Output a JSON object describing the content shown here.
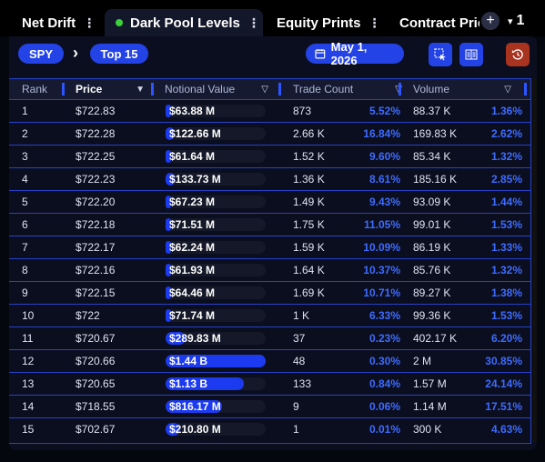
{
  "tabs": [
    {
      "label": "Net Drift",
      "kebab": "⋮"
    },
    {
      "label": "Dark Pool Levels",
      "kebab": "⋮"
    },
    {
      "label": "Equity Prints",
      "kebab": "⋮"
    },
    {
      "label": "Contract Pric"
    }
  ],
  "tabbar": {
    "plus": "+",
    "more_caret": "▾",
    "more_count": "1"
  },
  "toolbar": {
    "ticker": "SPY",
    "chevron": "›",
    "filter": "Top 15",
    "date": "May 1, 2026"
  },
  "columns": {
    "rank": "Rank",
    "price": "Price",
    "notional": "Notional Value",
    "trade_count": "Trade Count",
    "volume": "Volume",
    "sort_desc": "▼",
    "filter_icon": "▽"
  },
  "rows": [
    {
      "rank": "1",
      "price": "$722.83",
      "notional": "$63.88 M",
      "notional_frac": 0.044,
      "trades": "873",
      "trades_pct": "5.52%",
      "volume": "88.37 K",
      "volume_pct": "1.36%"
    },
    {
      "rank": "2",
      "price": "$722.28",
      "notional": "$122.66 M",
      "notional_frac": 0.085,
      "trades": "2.66 K",
      "trades_pct": "16.84%",
      "volume": "169.83 K",
      "volume_pct": "2.62%"
    },
    {
      "rank": "3",
      "price": "$722.25",
      "notional": "$61.64 M",
      "notional_frac": 0.043,
      "trades": "1.52 K",
      "trades_pct": "9.60%",
      "volume": "85.34 K",
      "volume_pct": "1.32%"
    },
    {
      "rank": "4",
      "price": "$722.23",
      "notional": "$133.73 M",
      "notional_frac": 0.093,
      "trades": "1.36 K",
      "trades_pct": "8.61%",
      "volume": "185.16 K",
      "volume_pct": "2.85%"
    },
    {
      "rank": "5",
      "price": "$722.20",
      "notional": "$67.23 M",
      "notional_frac": 0.047,
      "trades": "1.49 K",
      "trades_pct": "9.43%",
      "volume": "93.09 K",
      "volume_pct": "1.44%"
    },
    {
      "rank": "6",
      "price": "$722.18",
      "notional": "$71.51 M",
      "notional_frac": 0.05,
      "trades": "1.75 K",
      "trades_pct": "11.05%",
      "volume": "99.01 K",
      "volume_pct": "1.53%"
    },
    {
      "rank": "7",
      "price": "$722.17",
      "notional": "$62.24 M",
      "notional_frac": 0.043,
      "trades": "1.59 K",
      "trades_pct": "10.09%",
      "volume": "86.19 K",
      "volume_pct": "1.33%"
    },
    {
      "rank": "8",
      "price": "$722.16",
      "notional": "$61.93 M",
      "notional_frac": 0.043,
      "trades": "1.64 K",
      "trades_pct": "10.37%",
      "volume": "85.76 K",
      "volume_pct": "1.32%"
    },
    {
      "rank": "9",
      "price": "$722.15",
      "notional": "$64.46 M",
      "notional_frac": 0.045,
      "trades": "1.69 K",
      "trades_pct": "10.71%",
      "volume": "89.27 K",
      "volume_pct": "1.38%"
    },
    {
      "rank": "10",
      "price": "$722",
      "notional": "$71.74 M",
      "notional_frac": 0.05,
      "trades": "1 K",
      "trades_pct": "6.33%",
      "volume": "99.36 K",
      "volume_pct": "1.53%"
    },
    {
      "rank": "11",
      "price": "$720.67",
      "notional": "$289.83 M",
      "notional_frac": 0.2,
      "trades": "37",
      "trades_pct": "0.23%",
      "volume": "402.17 K",
      "volume_pct": "6.20%"
    },
    {
      "rank": "12",
      "price": "$720.66",
      "notional": "$1.44 B",
      "notional_frac": 1.0,
      "trades": "48",
      "trades_pct": "0.30%",
      "volume": "2 M",
      "volume_pct": "30.85%"
    },
    {
      "rank": "13",
      "price": "$720.65",
      "notional": "$1.13 B",
      "notional_frac": 0.785,
      "trades": "133",
      "trades_pct": "0.84%",
      "volume": "1.57 M",
      "volume_pct": "24.14%"
    },
    {
      "rank": "14",
      "price": "$718.55",
      "notional": "$816.17 M",
      "notional_frac": 0.567,
      "trades": "9",
      "trades_pct": "0.06%",
      "volume": "1.14 M",
      "volume_pct": "17.51%"
    },
    {
      "rank": "15",
      "price": "$702.67",
      "notional": "$210.80 M",
      "notional_frac": 0.146,
      "trades": "1",
      "trades_pct": "0.01%",
      "volume": "300 K",
      "volume_pct": "4.63%"
    }
  ],
  "colors": {
    "accent": "#2443e6",
    "pct": "#3d6bff",
    "active_dot": "#3ad13a",
    "reset": "#a8331f"
  }
}
